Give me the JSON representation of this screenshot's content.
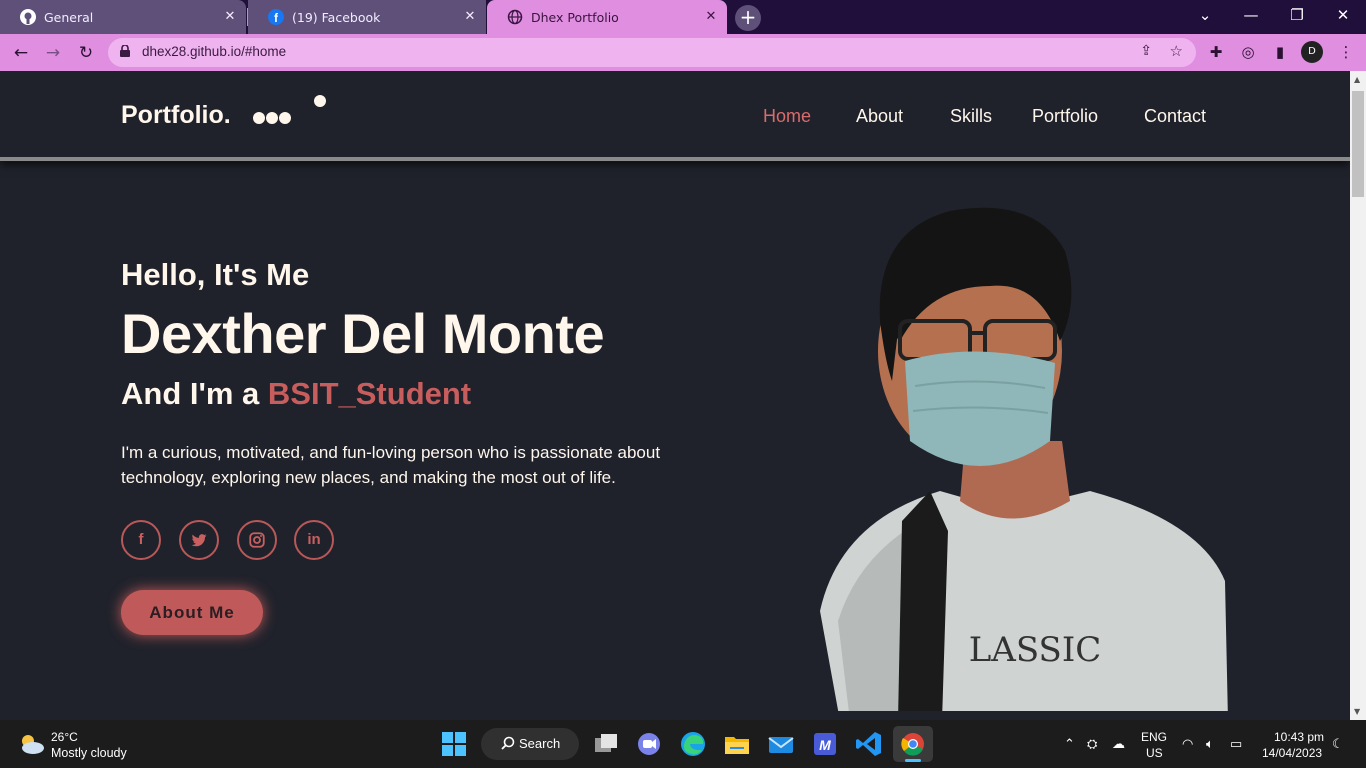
{
  "browser": {
    "tabs": [
      {
        "title": "General",
        "icon": "github-icon",
        "state": "inactive"
      },
      {
        "title": "(19) Facebook",
        "icon": "facebook-icon",
        "state": "inactive"
      },
      {
        "title": "Dhex Portfolio",
        "icon": "globe-icon",
        "state": "active"
      }
    ],
    "new_tab": "+",
    "url": "dhex28.github.io/#home",
    "profile_initial": "D",
    "accent": "#e08ee0"
  },
  "page": {
    "logo": "Portfolio.",
    "nav": [
      "Home",
      "About",
      "Skills",
      "Portfolio",
      "Contact"
    ],
    "active_nav": "Home",
    "greeting": "Hello, It's Me",
    "name": "Dexther Del Monte",
    "role_prefix": "And I'm a",
    "role_highlight": "BSIT_Student",
    "bio": "I'm a curious, motivated, and fun-loving person who is passionate about technology, exploring new places, and making the most out of life.",
    "social": [
      {
        "name": "facebook",
        "glyph": "f"
      },
      {
        "name": "twitter",
        "glyph": "t"
      },
      {
        "name": "instagram",
        "glyph": "◎"
      },
      {
        "name": "linkedin",
        "glyph": "in"
      }
    ],
    "cta": "About Me",
    "shirt_text": "LASSIC",
    "colors": {
      "background": "#1f222b",
      "accent": "#c05a5a",
      "text": "#fff6ec"
    }
  },
  "taskbar": {
    "weather_temp": "26°C",
    "weather_desc": "Mostly cloudy",
    "search_label": "Search",
    "lang_top": "ENG",
    "lang_bottom": "US",
    "time": "10:43 pm",
    "date": "14/04/2023"
  }
}
